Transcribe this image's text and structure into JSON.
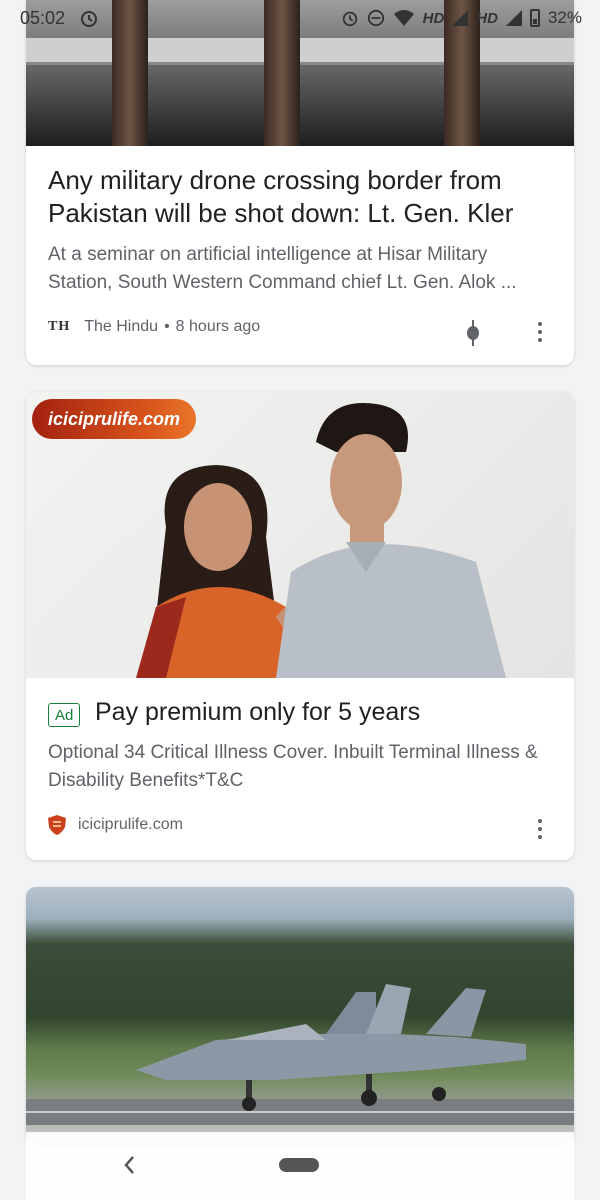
{
  "status_bar": {
    "time": "05:02",
    "network_1": "HD",
    "network_2": "HD",
    "battery": "32%",
    "icons": [
      "alarm-icon",
      "do-not-disturb-icon",
      "wifi-icon",
      "signal-icon",
      "battery-icon"
    ]
  },
  "feed": {
    "cards": [
      {
        "type": "news",
        "image": "rifles-on-rack-image",
        "headline": "Any military drone crossing border from Pakistan will be shot down: Lt. Gen. Kler",
        "snippet": "At a seminar on artificial intelligence at Hisar Military Station, South Western Command chief Lt. Gen. Alok ...",
        "source_logo": "TH",
        "source": "The Hindu",
        "time_ago": "8 hours ago"
      },
      {
        "type": "ad",
        "image": "couple-advertisement-image",
        "image_overlay_text": "iciciprulife.com",
        "badge": "Ad",
        "title": "Pay premium only for 5 years",
        "description": "Optional 34 Critical Illness Cover. Inbuilt Terminal Illness & Disability Benefits*T&C",
        "source": "iciciprulife.com"
      },
      {
        "type": "news",
        "image": "fighter-jets-on-runway-image"
      }
    ]
  },
  "colors": {
    "ad_green": "#188038",
    "ad_pill": "#c9401a",
    "text_primary": "#202124",
    "text_secondary": "#5f6368"
  }
}
